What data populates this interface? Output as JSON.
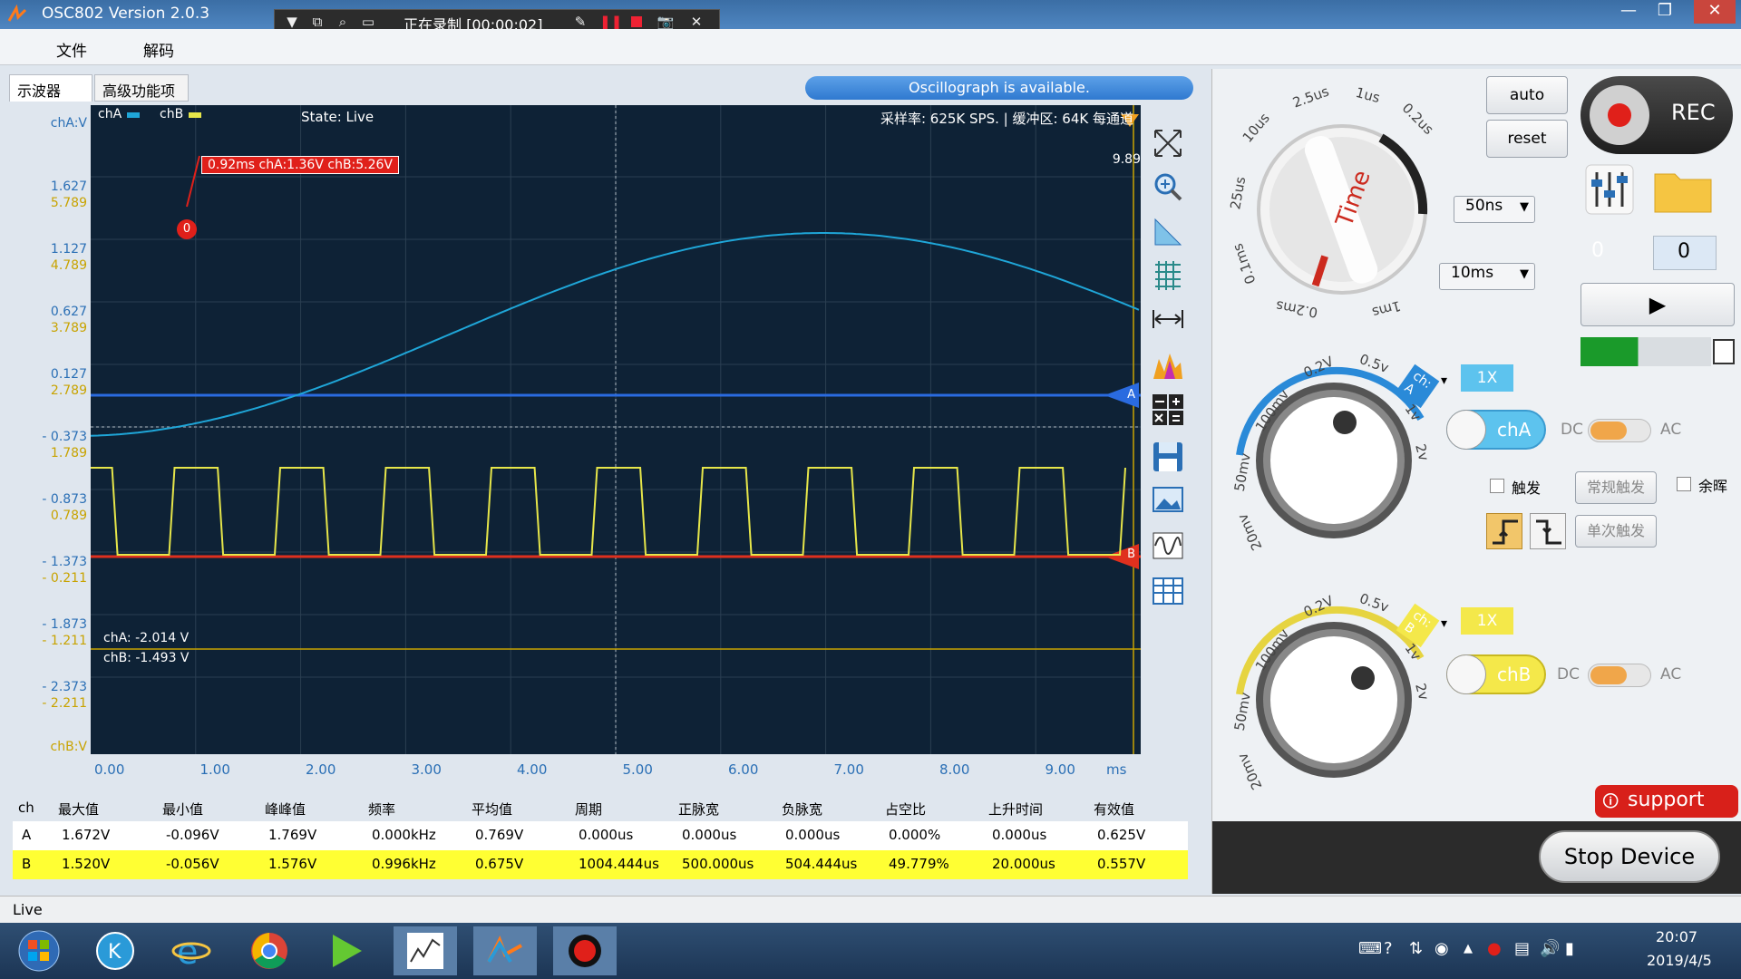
{
  "window": {
    "title": "OSC802  Version 2.0.3",
    "minimize": "—",
    "restore": "❐",
    "close": "✕"
  },
  "recording": {
    "status": "正在录制 [00:00:02]"
  },
  "menu": {
    "file": "文件",
    "decode": "解码"
  },
  "tabs": [
    {
      "label": "示波器"
    },
    {
      "label": "高级功能项"
    }
  ],
  "status_banner": "Oscillograph  is available.",
  "plot": {
    "legend_a": "chA",
    "legend_b": "chB",
    "state": "State: Live",
    "info": "采样率: 625K SPS. | 缓冲区: 64K 每通道",
    "cursor_label": "0.92ms chA:1.36V chB:5.26V",
    "cursor_marker": "0",
    "trigger_value": "9.89",
    "marker_a": "A",
    "marker_b": "B",
    "readout_a": "chA: -2.014 V",
    "readout_b": "chB: -1.493 V",
    "y_top_label": "chA:V",
    "y_bottom_label": "chB:V",
    "y_labels_a": [
      "1.627",
      "1.127",
      "0.627",
      "0.127",
      "- 0.373",
      "- 0.873",
      "- 1.373",
      "- 1.873",
      "- 2.373"
    ],
    "y_labels_b": [
      "5.789",
      "4.789",
      "3.789",
      "2.789",
      "1.789",
      "0.789",
      "- 0.211",
      "- 1.211",
      "- 2.211"
    ],
    "x_labels": [
      "0.00",
      "1.00",
      "2.00",
      "3.00",
      "4.00",
      "5.00",
      "6.00",
      "7.00",
      "8.00",
      "9.00"
    ],
    "x_unit": "ms",
    "colors": {
      "background": "#0e2236",
      "chA": "#1fa6d8",
      "chB": "#e6e64a",
      "refA": "#2a6be0",
      "refB": "#e0301e",
      "cursor_label_bg": "#e0201a"
    }
  },
  "measurements": {
    "headers": [
      "ch",
      "最大值",
      "最小值",
      "峰峰值",
      "频率",
      "平均值",
      "周期",
      "正脉宽",
      "负脉宽",
      "占空比",
      "上升时间",
      "有效值"
    ],
    "rows": [
      [
        "A",
        "1.672V",
        "-0.096V",
        "1.769V",
        "0.000kHz",
        "0.769V",
        "0.000us",
        "0.000us",
        "0.000us",
        "0.000%",
        "0.000us",
        "0.625V"
      ],
      [
        "B",
        "1.520V",
        "-0.056V",
        "1.576V",
        "0.996kHz",
        "0.675V",
        "1004.444us",
        "500.000us",
        "504.444us",
        "49.779%",
        "20.000us",
        "0.557V"
      ]
    ]
  },
  "time_knob": {
    "label": "Time",
    "scale": [
      "10us",
      "2.5us",
      "1us",
      "0.2us",
      "25us",
      "0.1ms",
      "0.2ms",
      "1ms"
    ],
    "select_fine": "50ns",
    "select_coarse": "10ms"
  },
  "buttons": {
    "auto": "auto",
    "reset": "reset",
    "rec": "REC",
    "support": "support",
    "stop_device": "Stop Device",
    "play": "▶"
  },
  "counters": {
    "left": "0",
    "right": "0"
  },
  "channel_a": {
    "tag": "ch: A",
    "scale": [
      "100mv",
      "0.2V",
      "0.5v",
      "1v",
      "2v",
      "50mv",
      "20mv"
    ],
    "probe": "1X",
    "toggle_label": "chA",
    "dc": "DC",
    "ac": "AC"
  },
  "channel_b": {
    "tag": "ch: B",
    "scale": [
      "100mv",
      "0.2V",
      "0.5v",
      "1v",
      "2v",
      "50mv",
      "20mv"
    ],
    "probe": "1X",
    "toggle_label": "chB",
    "dc": "DC",
    "ac": "AC"
  },
  "trigger": {
    "label": "触发",
    "normal": "常规触发",
    "single": "单次触发",
    "afterglow": "余晖"
  },
  "statusbar": {
    "text": "Live"
  },
  "taskbar": {
    "time": "20:07",
    "date": "2019/4/5"
  }
}
